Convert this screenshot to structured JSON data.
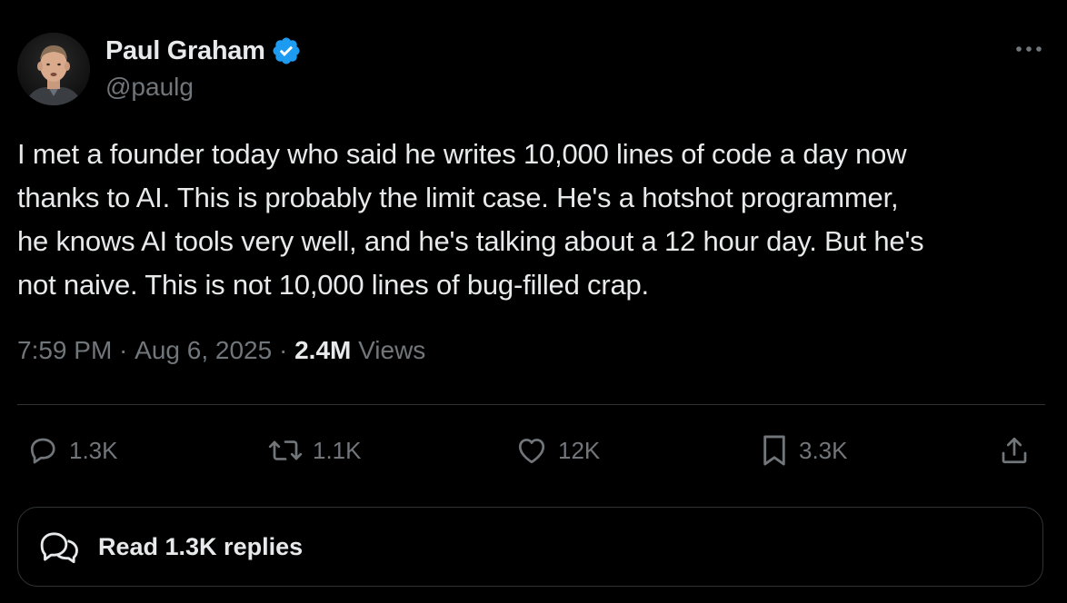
{
  "author": {
    "name": "Paul Graham",
    "handle": "@paulg",
    "verified_color": "#1d9bf0"
  },
  "tweet": {
    "text": "I met a founder today who said he writes 10,000 lines of code a day now\nthanks to AI. This is probably the limit case. He's a hotshot programmer,\nhe knows AI tools very well, and he's talking about a 12 hour day. But he's\nnot naive. This is not 10,000 lines of bug-filled crap.",
    "time": "7:59 PM",
    "separator": " · ",
    "date": "Aug 6, 2025",
    "views_count": "2.4M",
    "views_label": " Views"
  },
  "actions": {
    "replies": "1.3K",
    "reposts": "1.1K",
    "likes": "12K",
    "bookmarks": "3.3K"
  },
  "read_replies": {
    "label": "Read 1.3K replies"
  },
  "icons": {
    "more": "more-horizontal-icon",
    "reply": "reply-icon",
    "repost": "repost-icon",
    "like": "heart-icon",
    "bookmark": "bookmark-icon",
    "share": "share-icon",
    "replies_bubble": "chat-bubbles-icon",
    "verified": "verified-badge-icon"
  },
  "colors": {
    "background": "#000000",
    "primary_text": "#e7e9ea",
    "secondary_text": "#71767b",
    "border": "#2f3336"
  }
}
